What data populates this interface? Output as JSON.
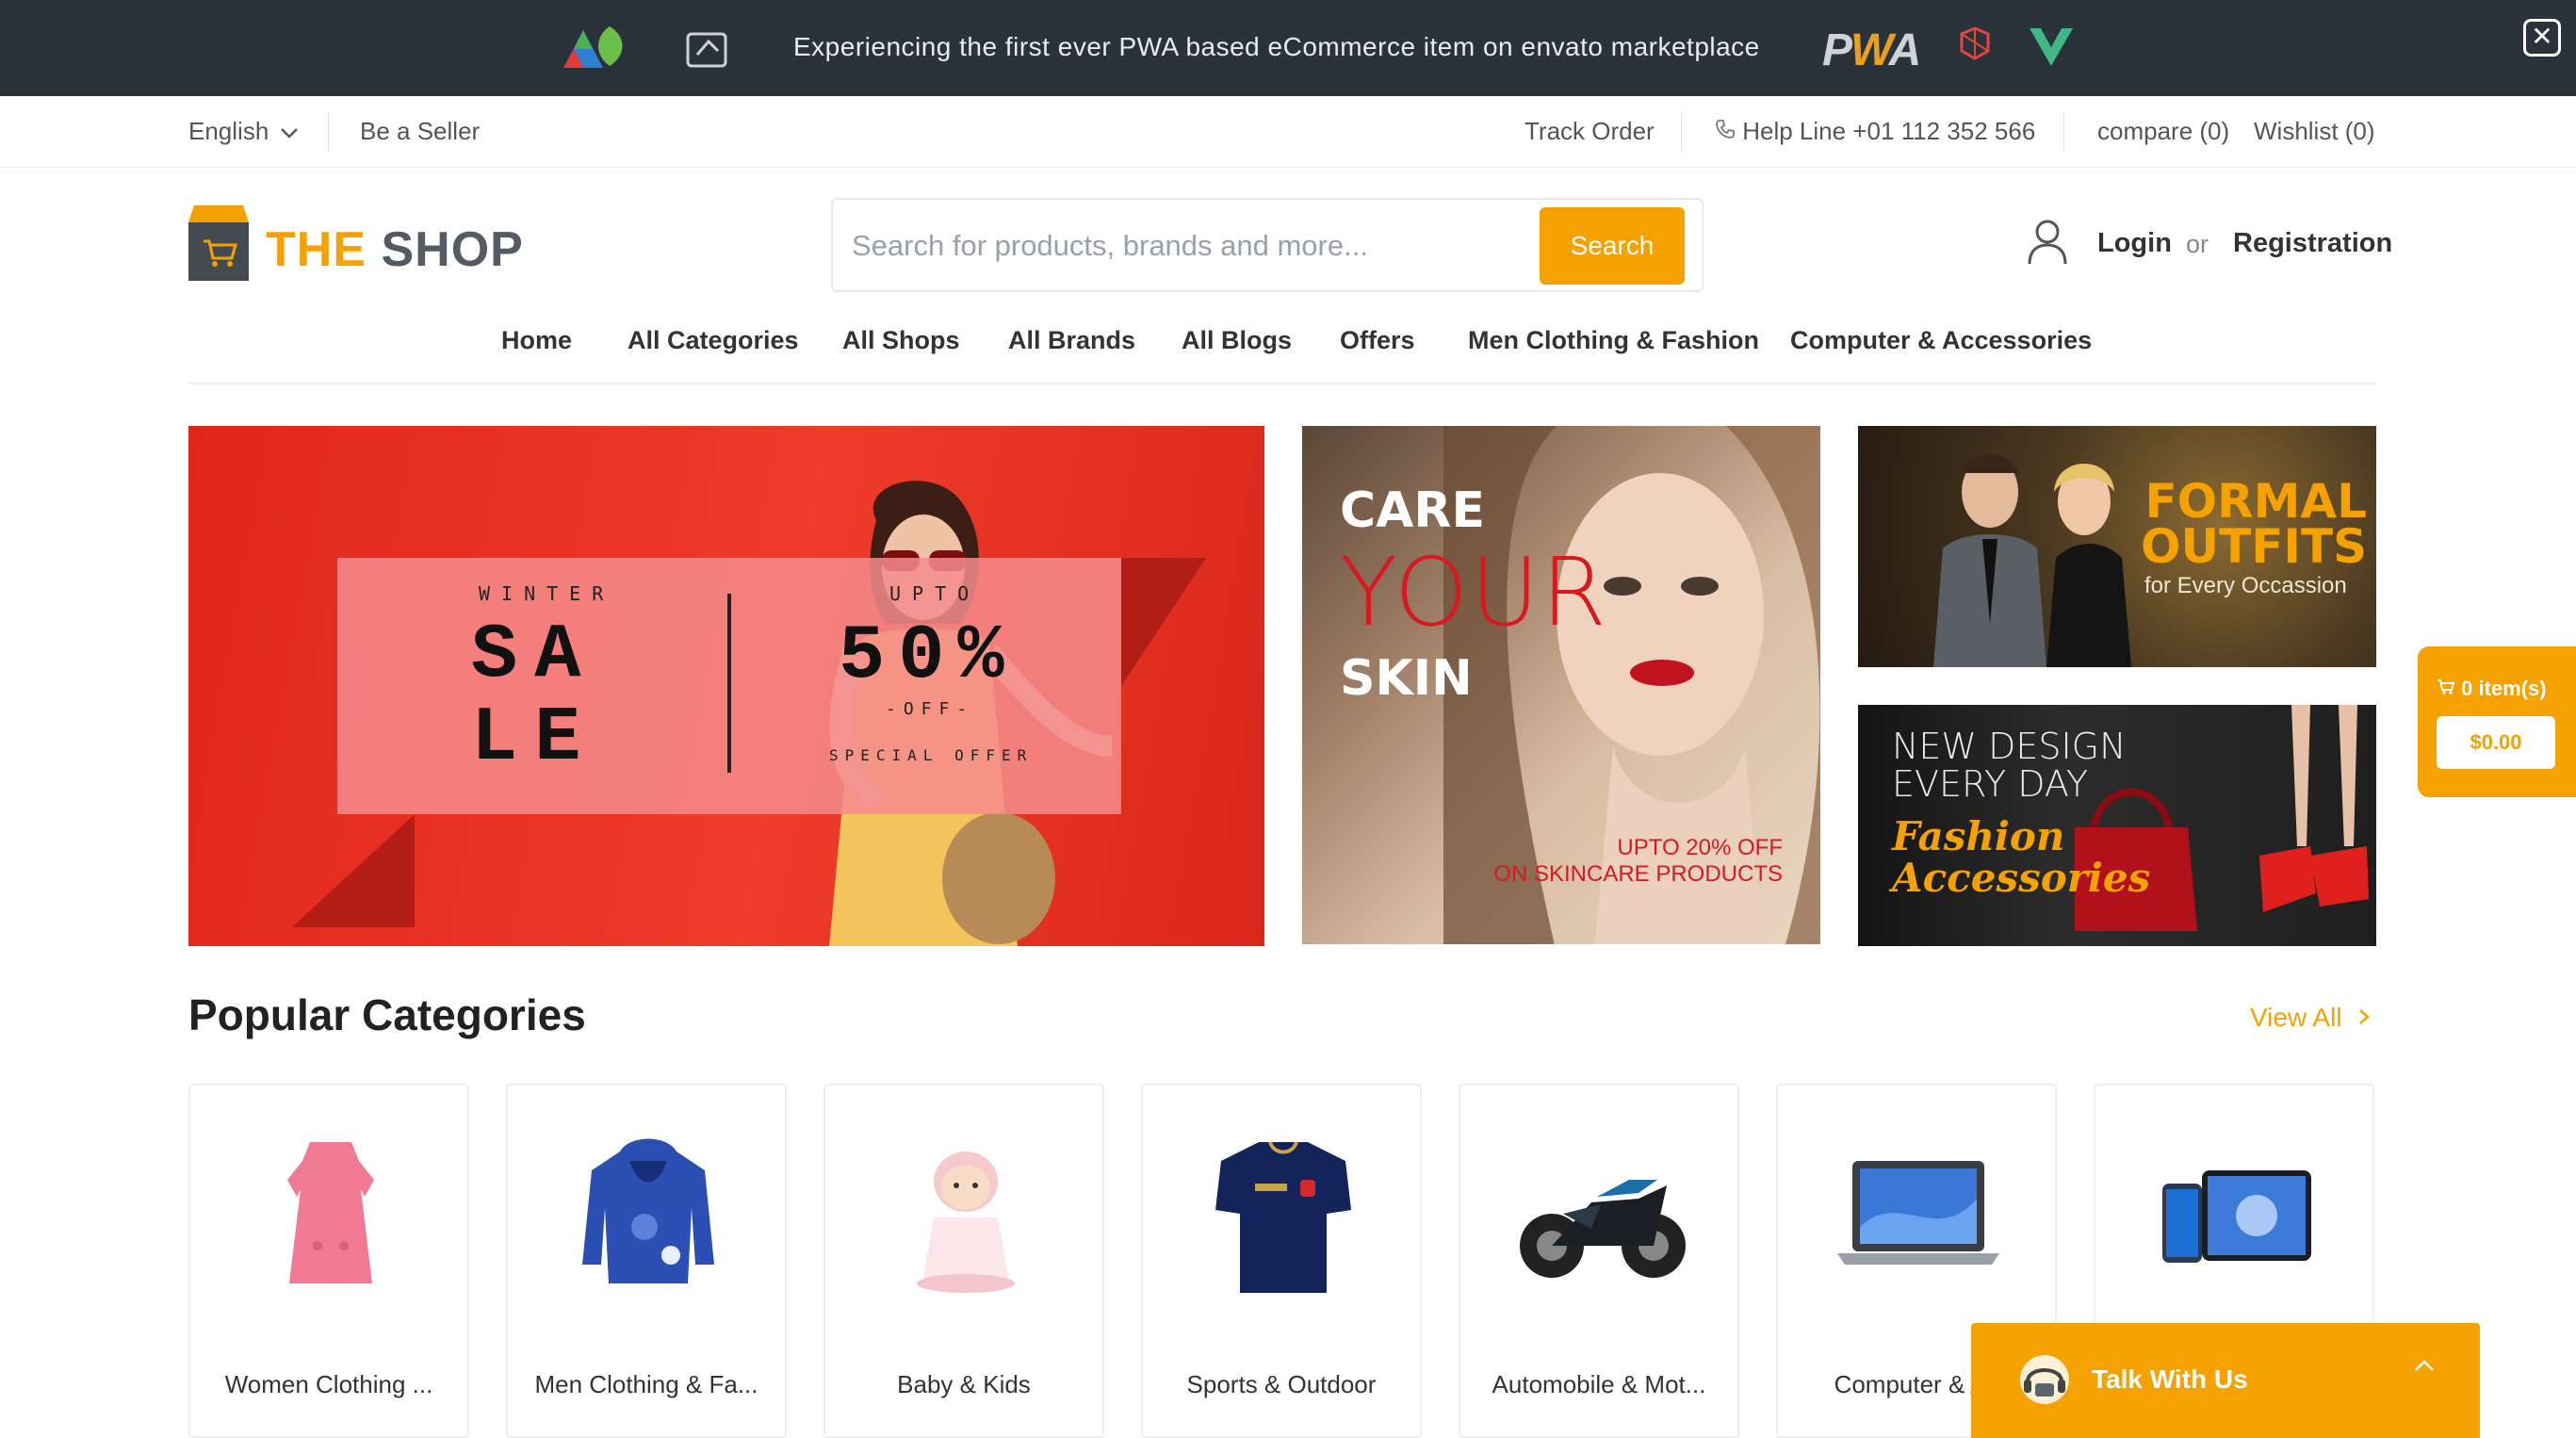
{
  "promo": {
    "text": "Experiencing the first ever PWA based eCommerce item on envato marketplace",
    "logo_text": "PWA",
    "close_symbol": "✕"
  },
  "topbar": {
    "language": "English",
    "be_seller": "Be a Seller",
    "track_order": "Track Order",
    "helpline": "Help Line +01 112 352 566",
    "compare": "compare (0)",
    "wishlist": "Wishlist (0)"
  },
  "header": {
    "brand_the": "THE",
    "brand_shop": "SHOP",
    "search_placeholder": "Search for products, brands and more...",
    "search_button": "Search",
    "login": "Login",
    "or": "or",
    "registration": "Registration"
  },
  "nav": {
    "items": [
      "Home",
      "All Categories",
      "All Shops",
      "All Brands",
      "All Blogs",
      "Offers",
      "Men Clothing & Fashion",
      "Computer & Accessories"
    ]
  },
  "banners": {
    "main": {
      "winter": "WINTER",
      "sale": "SA LE",
      "upto": "UPTO",
      "percent": "50%",
      "off": "-OFF-",
      "special": "SPECIAL OFFER"
    },
    "skin": {
      "care": "CARE",
      "your": "YOUR",
      "skin": "SKIN",
      "offer_line1": "UPTO 20% OFF",
      "offer_line2": "ON SKINCARE PRODUCTS"
    },
    "formal": {
      "title": "FORMAL OUTFITS",
      "subtitle": "for Every Occassion"
    },
    "fashion": {
      "line1": "NEW DESIGN",
      "line2": "EVERY DAY",
      "line3": "Fashion",
      "line4": "Accessories"
    }
  },
  "cart": {
    "items": "0 item(s)",
    "total": "$0.00"
  },
  "popular": {
    "title": "Popular Categories",
    "view_all": "View All",
    "categories": [
      {
        "label": "Women Clothing ...",
        "icon": "dress-icon"
      },
      {
        "label": "Men Clothing & Fa...",
        "icon": "hoodie-icon"
      },
      {
        "label": "Baby & Kids",
        "icon": "doll-icon"
      },
      {
        "label": "Sports & Outdoor",
        "icon": "jersey-icon"
      },
      {
        "label": "Automobile & Mot...",
        "icon": "motorcycle-icon"
      },
      {
        "label": "Computer & Ac",
        "icon": "laptop-icon"
      },
      {
        "label": "",
        "icon": "tablet-phone-icon"
      }
    ]
  },
  "chat": {
    "label": "Talk With Us"
  },
  "colors": {
    "accent": "#f5a100",
    "promo_bg": "#2a323c",
    "sale_red": "#e1261c"
  }
}
